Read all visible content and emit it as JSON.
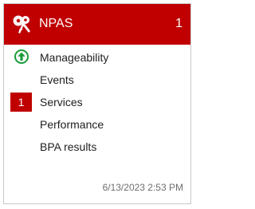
{
  "tile": {
    "title": "NPAS",
    "count": "1",
    "header_icon": "keys-icon",
    "colors": {
      "header_bg": "#c00000",
      "status_ok": "#1a9c3a",
      "badge_bg": "#c00000"
    },
    "items": [
      {
        "label": "Manageability",
        "status": "ok",
        "status_icon": "up-arrow-circle-icon"
      },
      {
        "label": "Events",
        "status": "none"
      },
      {
        "label": "Services",
        "status": "alert",
        "badge": "1"
      },
      {
        "label": "Performance",
        "status": "none"
      },
      {
        "label": "BPA results",
        "status": "none"
      }
    ],
    "timestamp": "6/13/2023 2:53 PM"
  }
}
